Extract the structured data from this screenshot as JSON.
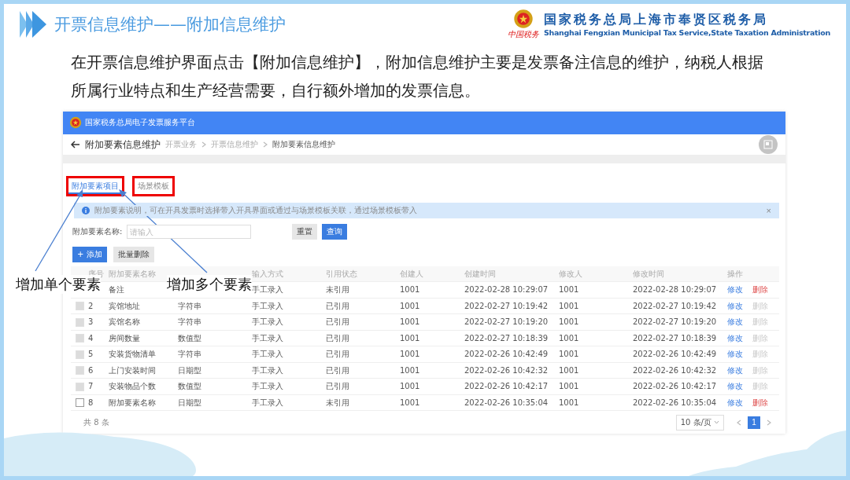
{
  "slide": {
    "title": "开票信息维护——附加信息维护",
    "org_name": "国家税务总局上海市奉贤区税务局",
    "org_name_en": "Shanghai Fengxian Municipal Tax Service,State Taxation Administration",
    "org_script": "中国税务",
    "paragraph": "在开票信息维护界面点击【附加信息维护】，附加信息维护主要是发票备注信息的维护，纳税人根据所属行业特点和生产经营需要，自行额外增加的发票信息。"
  },
  "app": {
    "platform_title": "国家税务总局电子发票服务平台",
    "page_title": "附加要素信息维护",
    "breadcrumb": [
      "开票业务",
      "开票信息维护",
      "附加要素信息维护"
    ],
    "tabs": [
      {
        "label": "附加要素项目",
        "selected": true
      },
      {
        "label": "场景模板",
        "selected": false
      }
    ],
    "info": "附加要素说明，可在开具发票时选择带入开具界面或通过与场景模板关联，通过场景模板带入",
    "info_close": "×",
    "search": {
      "label": "附加要素名称:",
      "placeholder": "请输入",
      "reset": "重置",
      "query": "查询"
    },
    "add_button": "+ 添加",
    "batch_delete": "批量删除",
    "table": {
      "columns": [
        "序号",
        "附加要素名称",
        "输入方式",
        "引用状态",
        "创建人",
        "创建时间",
        "修改人",
        "修改时间",
        "操作"
      ],
      "rows": [
        {
          "name": "备注",
          "input": "手工录入",
          "status": "未引用",
          "creator": "1001",
          "created": "2022-02-28 10:29:07",
          "modifier": "1001",
          "modified": "2022-02-28 10:29:07",
          "edit": "修改",
          "delete": "删除",
          "disabled": false
        },
        {
          "index": "2",
          "name": "宾馆地址",
          "type": "字符串",
          "input": "手工录入",
          "status": "已引用",
          "creator": "1001",
          "created": "2022-02-27 10:19:42",
          "modifier": "1001",
          "modified": "2022-02-27 10:19:42",
          "edit": "修改",
          "delete": "删除",
          "disabled": true
        },
        {
          "index": "3",
          "name": "宾馆名称",
          "type": "字符串",
          "input": "手工录入",
          "status": "已引用",
          "creator": "1001",
          "created": "2022-02-27 10:19:20",
          "modifier": "1001",
          "modified": "2022-02-27 10:19:20",
          "edit": "修改",
          "delete": "删除",
          "disabled": true
        },
        {
          "index": "4",
          "name": "房间数量",
          "type": "数值型",
          "input": "手工录入",
          "status": "已引用",
          "creator": "1001",
          "created": "2022-02-27 10:18:39",
          "modifier": "1001",
          "modified": "2022-02-27 10:18:39",
          "edit": "修改",
          "delete": "删除",
          "disabled": true
        },
        {
          "index": "5",
          "name": "安装货物清单",
          "type": "字符串",
          "input": "手工录入",
          "status": "已引用",
          "creator": "1001",
          "created": "2022-02-26 10:42:49",
          "modifier": "1001",
          "modified": "2022-02-26 10:42:49",
          "edit": "修改",
          "delete": "删除",
          "disabled": true
        },
        {
          "index": "6",
          "name": "上门安装时间",
          "type": "日期型",
          "input": "手工录入",
          "status": "已引用",
          "creator": "1001",
          "created": "2022-02-26 10:42:32",
          "modifier": "1001",
          "modified": "2022-02-26 10:42:32",
          "edit": "修改",
          "delete": "删除",
          "disabled": true
        },
        {
          "index": "7",
          "name": "安装物品个数",
          "type": "数值型",
          "input": "手工录入",
          "status": "已引用",
          "creator": "1001",
          "created": "2022-02-26 10:42:17",
          "modifier": "1001",
          "modified": "2022-02-26 10:42:17",
          "edit": "修改",
          "delete": "删除",
          "disabled": true
        },
        {
          "index": "8",
          "name": "附加要素名称",
          "type": "日期型",
          "input": "手工录入",
          "status": "未引用",
          "creator": "1001",
          "created": "2022-02-26 10:35:04",
          "modifier": "1001",
          "modified": "2022-02-26 10:35:04",
          "edit": "修改",
          "delete": "删除",
          "disabled": false
        }
      ]
    },
    "total": "共 8 条",
    "page_size": "10 条/页",
    "pages": [
      {
        "label": "1",
        "selected": true
      }
    ]
  },
  "annotations": [
    "增加单个要素",
    "增加多个要素"
  ]
}
